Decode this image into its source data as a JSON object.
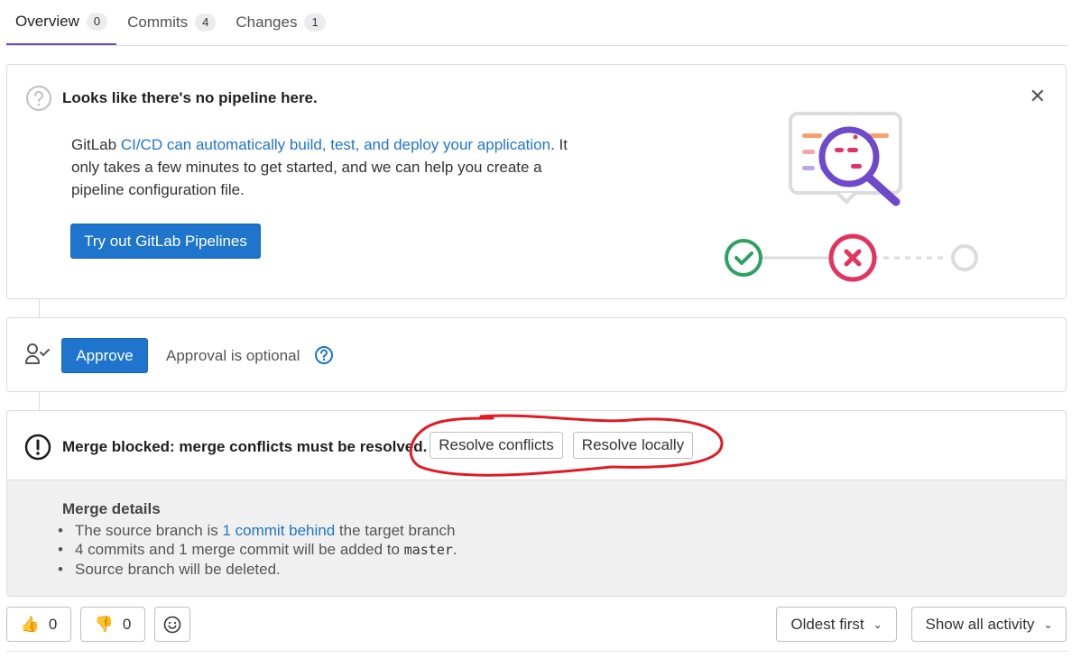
{
  "tabs": [
    {
      "label": "Overview",
      "count": "0"
    },
    {
      "label": "Commits",
      "count": "4"
    },
    {
      "label": "Changes",
      "count": "1"
    }
  ],
  "pipeline": {
    "title": "Looks like there's no pipeline here.",
    "text_prefix": "GitLab ",
    "text_link": "CI/CD can automatically build, test, and deploy your application",
    "text_suffix": ". It only takes a few minutes to get started, and we can help you create a pipeline configuration file.",
    "button_label": "Try out GitLab Pipelines",
    "close_icon": "close-icon"
  },
  "approval": {
    "button_label": "Approve",
    "text": "Approval is optional"
  },
  "merge": {
    "status_text": "Merge blocked: merge conflicts must be resolved.",
    "resolve_conflicts_label": "Resolve conflicts",
    "resolve_locally_label": "Resolve locally",
    "details_title": "Merge details",
    "detail1_prefix": "The source branch is ",
    "detail1_link": "1 commit behind",
    "detail1_suffix": " the target branch",
    "detail2_prefix": "4 commits and 1 merge commit will be added to ",
    "detail2_code": "master",
    "detail2_suffix": ".",
    "detail3": "Source branch will be deleted."
  },
  "footer": {
    "thumbs_up_count": "0",
    "thumbs_down_count": "0",
    "sort_label": "Oldest first",
    "activity_label": "Show all activity"
  },
  "colors": {
    "primary": "#1f75cb",
    "active_tab": "#6e49cb",
    "annotation": "#e01b24"
  }
}
